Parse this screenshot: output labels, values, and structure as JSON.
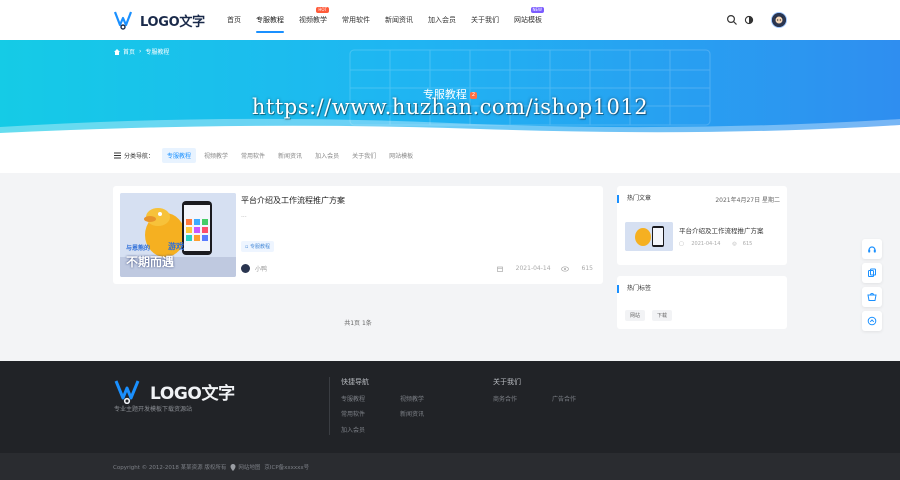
{
  "header": {
    "logo_text": "LOGO文字",
    "nav": [
      {
        "label": "首页",
        "active": false,
        "badge": ""
      },
      {
        "label": "专服教程",
        "active": true,
        "badge": ""
      },
      {
        "label": "视频教学",
        "active": false,
        "badge": "HOT"
      },
      {
        "label": "常用软件",
        "active": false,
        "badge": ""
      },
      {
        "label": "新闻资讯",
        "active": false,
        "badge": ""
      },
      {
        "label": "加入会员",
        "active": false,
        "badge": ""
      },
      {
        "label": "关于我们",
        "active": false,
        "badge": ""
      },
      {
        "label": "网站模板",
        "active": false,
        "badge": "NEW"
      }
    ],
    "icons": [
      "search-icon",
      "theme-icon",
      "avatar"
    ]
  },
  "banner": {
    "breadcrumb": [
      "首页",
      "专服教程"
    ],
    "title": "专服教程",
    "title_tag": "2",
    "watermark": "https://www.huzhan.com/ishop1012"
  },
  "category_bar": {
    "label": "分类导航：",
    "items": [
      "专服教程",
      "视频教学",
      "常用软件",
      "新闻资讯",
      "加入会员",
      "关于我们",
      "网站模板"
    ],
    "active_index": 0
  },
  "post": {
    "title": "平台介绍及工作流程推广方案",
    "excerpt": "...",
    "tag": "专服教程",
    "author": "小鸭",
    "date": "2021-04-14",
    "views": "615",
    "thumb_text_1": "与恩熊的",
    "thumb_text_2": "游戏",
    "thumb_text_3": "不期而遇"
  },
  "pagination": {
    "text": "共1页 1条"
  },
  "sidebar": {
    "hot_title": "热门文章",
    "hot_date": "2021年4月27日 星期二",
    "hot_post": {
      "title": "平台介绍及工作流程推广方案",
      "date": "2021-04-14",
      "views": "615"
    },
    "tags_title": "热门标签",
    "tags": [
      "网站",
      "下载"
    ]
  },
  "float_buttons": [
    "service-icon",
    "copy-icon",
    "shop-icon",
    "top-icon"
  ],
  "footer": {
    "logo_text": "LOGO文字",
    "slogan": "专业主题开发模板下载资源站",
    "col1_title": "快捷导航",
    "col1_links": [
      "专服教程",
      "视频教学",
      "常用软件",
      "新闻资讯",
      "加入会员"
    ],
    "col2_title": "关于我们",
    "col2_links": [
      "商务合作",
      "广告合作"
    ],
    "copyright": "Copyright © 2012-2018 某某资源 版权所有",
    "sitemap": "网站地图",
    "icp": "京ICP备xxxxxx号"
  },
  "colors": {
    "accent": "#1a90ff",
    "banner_start": "#15cbe6",
    "banner_end": "#2f8ef0",
    "footer_bg": "#212327"
  }
}
